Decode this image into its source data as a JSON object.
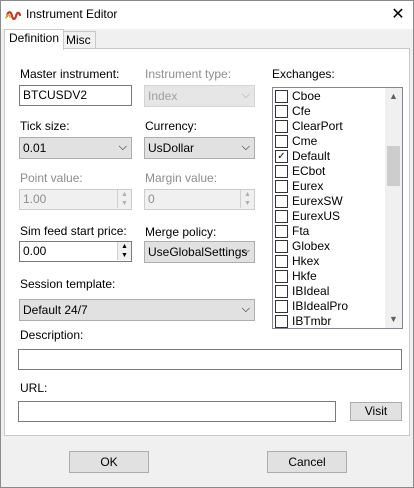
{
  "window": {
    "title": "Instrument Editor",
    "close_glyph": "✕"
  },
  "tabs": [
    {
      "label": "Definition",
      "selected": true
    },
    {
      "label": "Misc",
      "selected": false
    }
  ],
  "form": {
    "master_instrument": {
      "label": "Master instrument:",
      "value": "BTCUSDV2"
    },
    "instrument_type": {
      "label": "Instrument type:",
      "value": "Index",
      "enabled": false
    },
    "tick_size": {
      "label": "Tick size:",
      "value": "0.01"
    },
    "currency": {
      "label": "Currency:",
      "value": "UsDollar"
    },
    "point_value": {
      "label": "Point value:",
      "value": "1.00",
      "enabled": false
    },
    "margin_value": {
      "label": "Margin value:",
      "value": "0",
      "enabled": false
    },
    "sim_feed_start_price": {
      "label": "Sim feed start price:",
      "value": "0.00"
    },
    "merge_policy": {
      "label": "Merge policy:",
      "value": "UseGlobalSettings"
    },
    "session_template": {
      "label": "Session template:",
      "value": "Default 24/7"
    },
    "description": {
      "label": "Description:",
      "value": ""
    },
    "url": {
      "label": "URL:",
      "value": "",
      "visit_label": "Visit"
    }
  },
  "exchanges": {
    "label": "Exchanges:",
    "items": [
      {
        "label": "Cboe",
        "checked": false
      },
      {
        "label": "Cfe",
        "checked": false
      },
      {
        "label": "ClearPort",
        "checked": false
      },
      {
        "label": "Cme",
        "checked": false
      },
      {
        "label": "Default",
        "checked": true
      },
      {
        "label": "ECbot",
        "checked": false
      },
      {
        "label": "Eurex",
        "checked": false
      },
      {
        "label": "EurexSW",
        "checked": false
      },
      {
        "label": "EurexUS",
        "checked": false
      },
      {
        "label": "Fta",
        "checked": false
      },
      {
        "label": "Globex",
        "checked": false
      },
      {
        "label": "Hkex",
        "checked": false
      },
      {
        "label": "Hkfe",
        "checked": false
      },
      {
        "label": "IBIdeal",
        "checked": false
      },
      {
        "label": "IBIdealPro",
        "checked": false
      },
      {
        "label": "IBTmbr",
        "checked": false
      }
    ]
  },
  "buttons": {
    "ok": "OK",
    "cancel": "Cancel"
  },
  "glyphs": {
    "dropdown": "⌵",
    "check": "✓",
    "up": "▲",
    "down": "▼"
  },
  "colors": {
    "disabled_text": "#8d8d8d",
    "panel_bg": "#ffffff",
    "window_bg": "#f0f0f0"
  }
}
